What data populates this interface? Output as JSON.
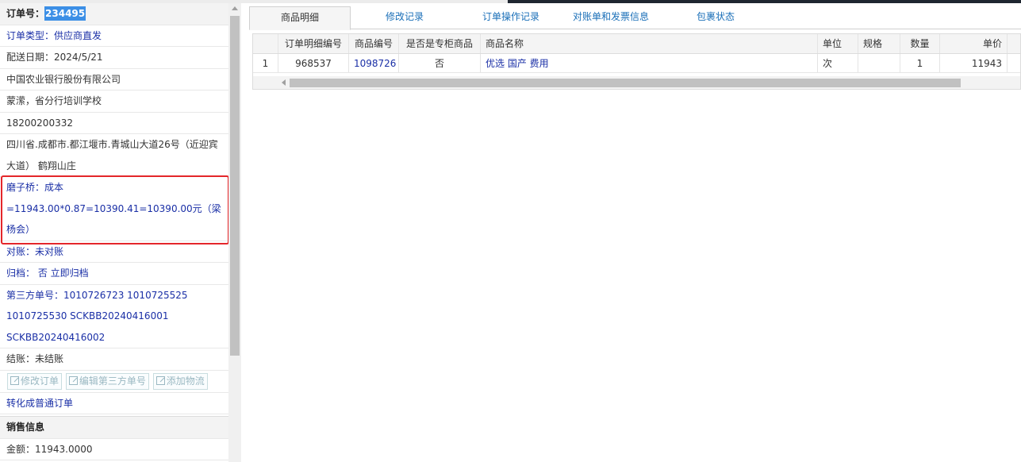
{
  "order": {
    "number_label": "订单号：",
    "number_value": "234495",
    "type": "订单类型：供应商直发",
    "delivery_date": "配送日期：2024/5/21",
    "company": "中国农业银行股份有限公司",
    "contact": "蒙潆，省分行培训学校",
    "phone": "18200200332",
    "address": "四川省.成都市.都江堰市.青城山大道26号（近迎宾大道） 鹤翔山庄",
    "cost_line1": "磨子桥：成本",
    "cost_line2": "=11943.00*0.87=10390.41=10390.00元（梁杨会）",
    "reconcile": "对账：未对账",
    "archive": "归档： 否 立即归档",
    "third_party": "第三方单号：1010726723 1010725525 1010725530 SCKBB20240416001 SCKBB20240416002",
    "settlement": "结账：未结账",
    "buttons": {
      "edit_order": "修改订单",
      "edit_third_party": "编辑第三方单号",
      "add_logistics": "添加物流"
    },
    "convert": "转化成普通订单"
  },
  "sales": {
    "header": "销售信息",
    "amount": "金额：11943.0000"
  },
  "tabs": [
    "商品明细",
    "修改记录",
    "订单操作记录",
    "对账单和发票信息",
    "包裹状态"
  ],
  "table": {
    "columns": [
      "订单明细编号",
      "商品编号",
      "是否是专柜商品",
      "商品名称",
      "单位",
      "规格",
      "数量",
      "单价"
    ],
    "rows": [
      {
        "index": "1",
        "detail_id": "968537",
        "product_id": "1098726",
        "is_counter": "否",
        "name": "优选 国产 费用",
        "unit": "次",
        "spec": "",
        "qty": "1",
        "price": "11943"
      }
    ]
  },
  "colors": {
    "highlight": "#3c8fe6",
    "link": "#1a2fa6",
    "tab_link": "#1a6fb8",
    "red_box": "#e4262a"
  }
}
